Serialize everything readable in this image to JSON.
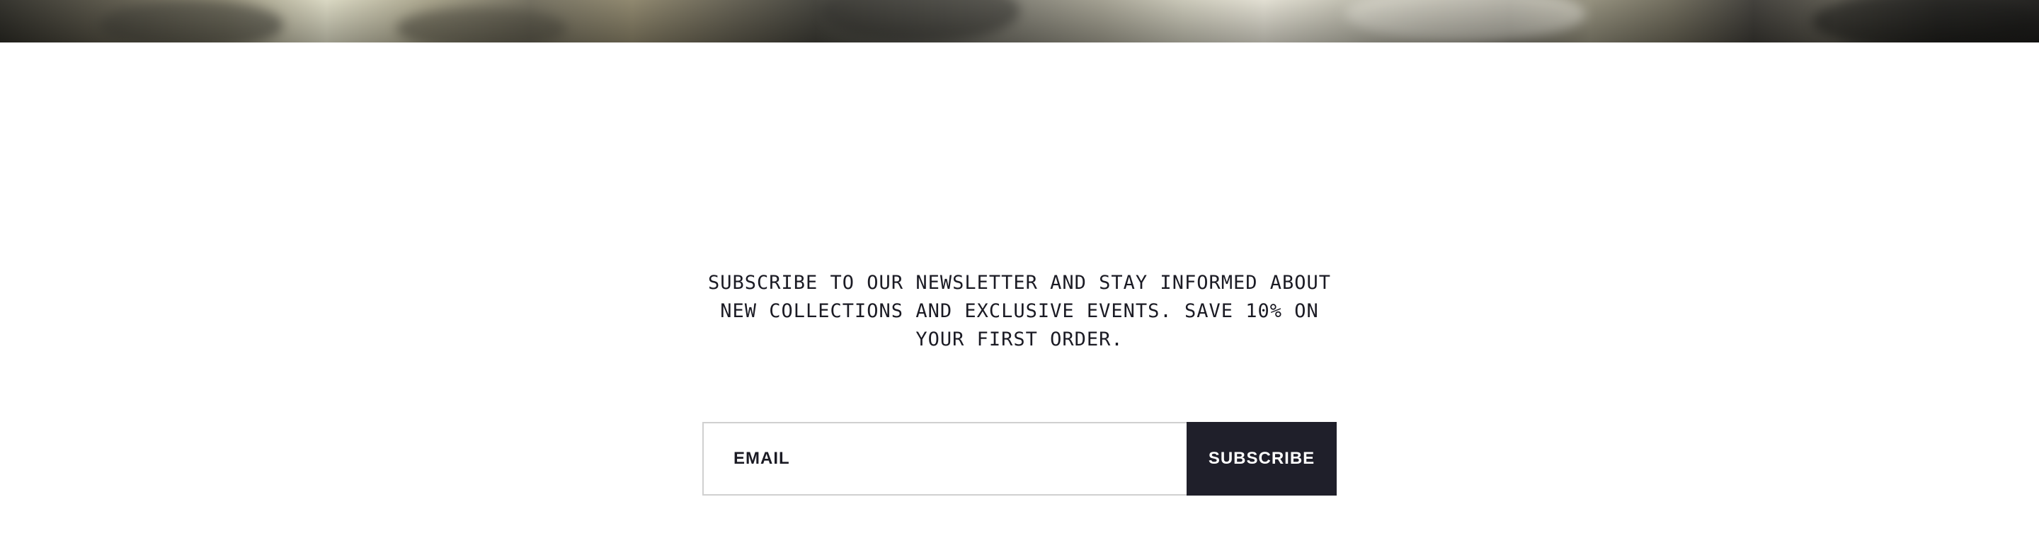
{
  "colors": {
    "background": "#ffffff",
    "text": "#1b1b24",
    "button_background": "#1f1f2a",
    "button_text": "#ffffff",
    "input_border": "#d0d0d0"
  },
  "newsletter": {
    "description": "SUBSCRIBE TO OUR NEWSLETTER AND STAY INFORMED ABOUT NEW COLLECTIONS AND EXCLUSIVE EVENTS. SAVE 10% ON YOUR FIRST ORDER.",
    "email_placeholder": "EMAIL",
    "email_value": "",
    "subscribe_label": "SUBSCRIBE"
  }
}
